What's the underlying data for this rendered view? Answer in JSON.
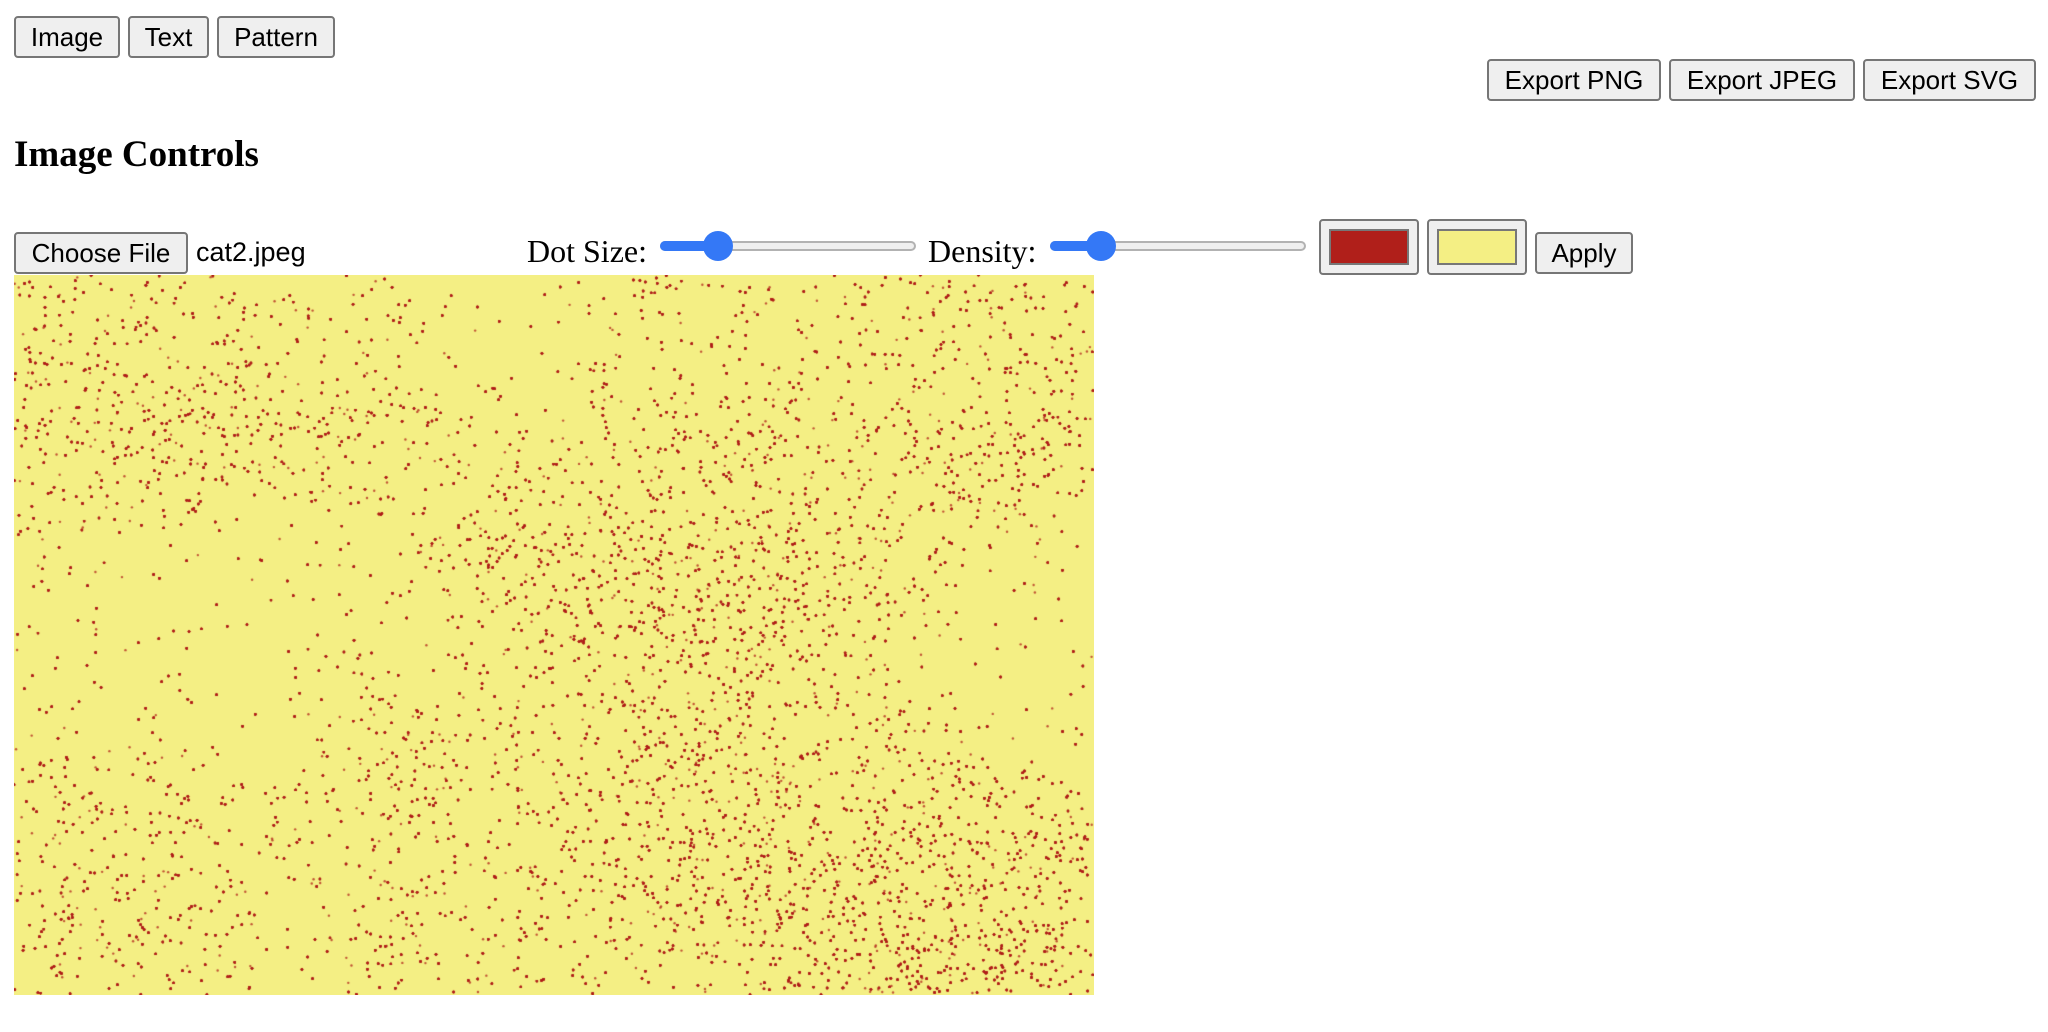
{
  "mode_tabs": [
    "Image",
    "Text",
    "Pattern"
  ],
  "export_buttons": [
    "Export PNG",
    "Export JPEG",
    "Export SVG"
  ],
  "heading": "Image Controls",
  "file": {
    "button_label": "Choose File",
    "filename": "cat2.jpeg"
  },
  "dot_size": {
    "label": "Dot Size:",
    "value_fraction": 0.19
  },
  "density": {
    "label": "Density:",
    "value_fraction": 0.16
  },
  "colors": {
    "dot_color": "#b01f1a",
    "background_color": "#f4ef84",
    "slider_accent": "#3478f6"
  },
  "apply_label": "Apply"
}
